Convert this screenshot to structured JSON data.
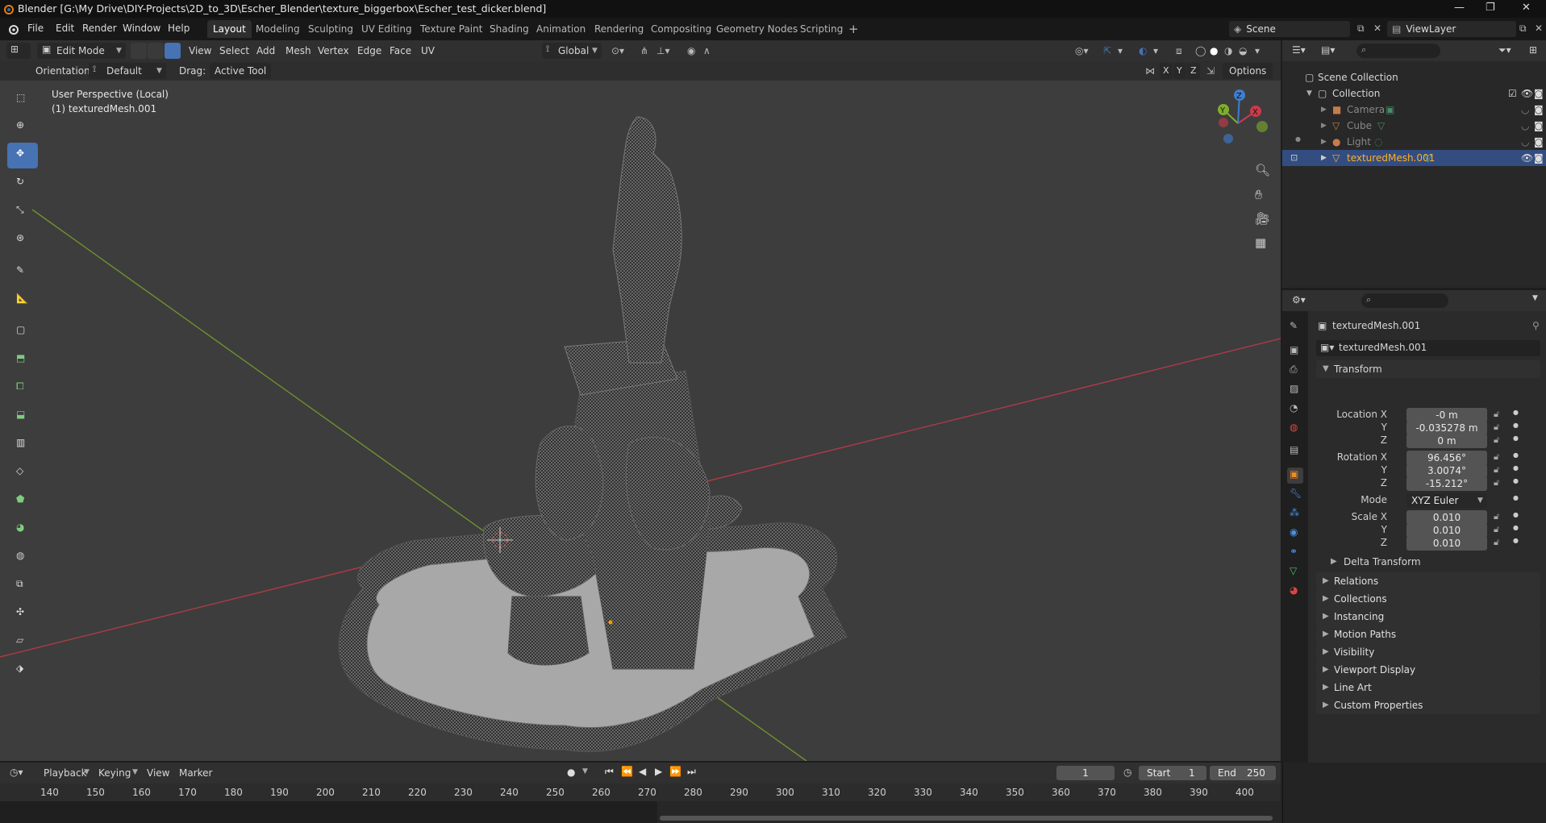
{
  "window": {
    "title": "Blender [G:\\My Drive\\DIY-Projects\\2D_to_3D\\Escher_Blender\\texture_biggerbox\\Escher_test_dicker.blend]"
  },
  "menu": {
    "items": [
      "File",
      "Edit",
      "Render",
      "Window",
      "Help"
    ],
    "workspaces": [
      "Layout",
      "Modeling",
      "Sculpting",
      "UV Editing",
      "Texture Paint",
      "Shading",
      "Animation",
      "Rendering",
      "Compositing",
      "Geometry Nodes",
      "Scripting"
    ],
    "add_tab": "+",
    "scene": "Scene",
    "view_layer": "ViewLayer"
  },
  "viewport": {
    "mode": "Edit Mode",
    "header_menus": [
      "View",
      "Select",
      "Add",
      "Mesh",
      "Vertex",
      "Edge",
      "Face",
      "UV"
    ],
    "transform_orientation": "Global",
    "orientation_label": "Orientation:",
    "orientation_value": "Default",
    "drag_label": "Drag:",
    "drag_value": "Active Tool",
    "axis_x": "X",
    "axis_y": "Y",
    "axis_z": "Z",
    "options_label": "Options",
    "overlay_line1": "User Perspective (Local)",
    "overlay_line2": "(1) texturedMesh.001",
    "gizmo_x": "X",
    "gizmo_y": "Y",
    "gizmo_z": "Z"
  },
  "outliner": {
    "root": "Scene Collection",
    "collection": "Collection",
    "items": [
      "Camera",
      "Cube",
      "Light",
      "texturedMesh.001"
    ],
    "selected": "texturedMesh.001"
  },
  "properties": {
    "object_name": "texturedMesh.001",
    "data_name": "texturedMesh.001",
    "transform_title": "Transform",
    "location_label": "Location X",
    "location": [
      "-0 m",
      "-0.035278 m",
      "0 m"
    ],
    "rotation_label": "Rotation X",
    "rotation": [
      "96.456°",
      "3.0074°",
      "-15.212°"
    ],
    "mode_label": "Mode",
    "mode_value": "XYZ Euler",
    "scale_label": "Scale X",
    "scale": [
      "0.010",
      "0.010",
      "0.010"
    ],
    "y_label": "Y",
    "z_label": "Z",
    "delta_transform": "Delta Transform",
    "panels": [
      "Relations",
      "Collections",
      "Instancing",
      "Motion Paths",
      "Visibility",
      "Viewport Display",
      "Line Art",
      "Custom Properties"
    ]
  },
  "timeline": {
    "menus": [
      "Playback",
      "Keying",
      "View",
      "Marker"
    ],
    "current_frame": "1",
    "start_label": "Start",
    "start": "1",
    "end_label": "End",
    "end": "250",
    "ticks": [
      "140",
      "150",
      "160",
      "170",
      "180",
      "190",
      "200",
      "210",
      "220",
      "230",
      "240",
      "250",
      "260",
      "270",
      "280",
      "290",
      "300",
      "310",
      "320",
      "330",
      "340",
      "350",
      "360",
      "370",
      "380",
      "390",
      "400"
    ]
  },
  "colors": {
    "accent": "#4772b3",
    "x_axis": "#cc3a4a",
    "y_axis": "#7fad2c",
    "z_axis": "#3f7ecf",
    "selected_text": "#ffaf29"
  }
}
